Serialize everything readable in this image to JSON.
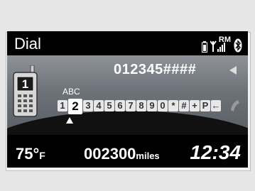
{
  "header": {
    "title": "Dial",
    "status_icons": [
      "phone-battery-icon",
      "signal-strength-icon",
      "roaming-icon",
      "bluetooth-icon"
    ],
    "roaming_label": "RM"
  },
  "dialer": {
    "number": "012345####",
    "letters": "ABC",
    "keys": [
      "1",
      "2",
      "3",
      "4",
      "5",
      "6",
      "7",
      "8",
      "9",
      "0",
      "*",
      "#",
      "+",
      "P",
      "←"
    ],
    "selected_key": "2"
  },
  "footer": {
    "temperature": "75°",
    "temperature_unit": "F",
    "odometer": "002300",
    "odometer_unit": "miles",
    "time": "12:34"
  },
  "colors": {
    "screen": "#000000",
    "panel": "#7a7f86",
    "text": "#ffffff"
  }
}
